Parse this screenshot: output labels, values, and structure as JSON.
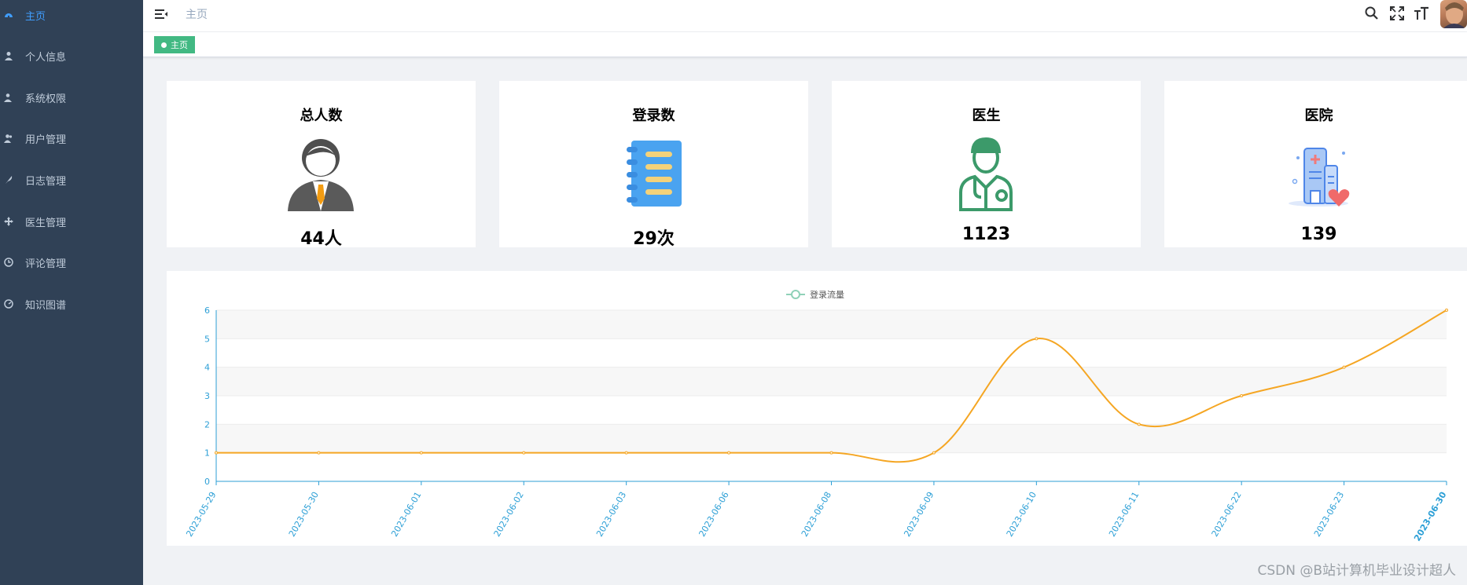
{
  "sidebar": {
    "items": [
      {
        "label": "主页",
        "icon": "dashboard-icon",
        "active": true
      },
      {
        "label": "个人信息",
        "icon": "user-icon"
      },
      {
        "label": "系统权限",
        "icon": "user-shield-icon"
      },
      {
        "label": "用户管理",
        "icon": "users-icon"
      },
      {
        "label": "日志管理",
        "icon": "feather-icon"
      },
      {
        "label": "医生管理",
        "icon": "move-icon"
      },
      {
        "label": "评论管理",
        "icon": "clock-icon"
      },
      {
        "label": "知识图谱",
        "icon": "gauge-icon"
      }
    ]
  },
  "navbar": {
    "breadcrumb": "主页",
    "tools": [
      "search-icon",
      "fullscreen-icon",
      "font-size-icon"
    ]
  },
  "tags": {
    "active_tag": "主页"
  },
  "cards": [
    {
      "title": "总人数",
      "value": "44人",
      "icon": "person-icon"
    },
    {
      "title": "登录数",
      "value": "29次",
      "icon": "notebook-icon"
    },
    {
      "title": "医生",
      "value": "1123",
      "icon": "doctor-icon"
    },
    {
      "title": "医院",
      "value": "139",
      "icon": "hospital-icon"
    }
  ],
  "colors": {
    "sidebar_bg": "#304156",
    "active": "#409eff",
    "tag": "#42b983",
    "line": "#f5a623",
    "axis": "#2c9fd6"
  },
  "chart_data": {
    "type": "line",
    "categories": [
      "2023-05-29",
      "2023-05-30",
      "2023-06-01",
      "2023-06-02",
      "2023-06-03",
      "2023-06-06",
      "2023-06-08",
      "2023-06-09",
      "2023-06-10",
      "2023-06-11",
      "2023-06-22",
      "2023-06-23",
      "2023-06-30"
    ],
    "series": [
      {
        "name": "登录流量",
        "values": [
          1,
          1,
          1,
          1,
          1,
          1,
          1,
          1,
          5,
          2,
          3,
          4,
          6
        ]
      }
    ],
    "ylim": [
      0,
      6
    ],
    "yticks": [
      0,
      1,
      2,
      3,
      4,
      5,
      6
    ],
    "legend": "top-center",
    "grid": true
  },
  "watermark": "CSDN @B站计算机毕业设计超人"
}
